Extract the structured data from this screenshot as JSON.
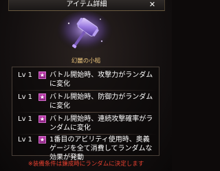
{
  "window": {
    "title": "アイテム詳細",
    "close_label": "✕"
  },
  "item": {
    "name": "幻麗の小槌",
    "icon": "magic-mallet-icon"
  },
  "skills": [
    {
      "level": "Lv 1",
      "icon": "star-icon",
      "lines": [
        "バトル開始時、攻撃力がランダム",
        "に変化"
      ]
    },
    {
      "level": "Lv 1",
      "icon": "star-icon",
      "lines": [
        "バトル開始時、防御力がランダム",
        "に変化"
      ]
    },
    {
      "level": "Lv 1",
      "icon": "star-icon",
      "lines": [
        "バトル開始時、連続攻撃確率がラ",
        "ンダムに変化"
      ]
    },
    {
      "level": "Lv 1",
      "icon": "star-icon",
      "lines": [
        "1番目のアビリティ使用時、奥義",
        "ゲージを全て消費してランダムな",
        "効果が発動"
      ]
    }
  ],
  "notice": "※装備条件は錬成時にランダムに決定します",
  "colors": {
    "item_name": "#e8c27a",
    "notice": "#e84030",
    "star_badge": "#b03aa8"
  }
}
